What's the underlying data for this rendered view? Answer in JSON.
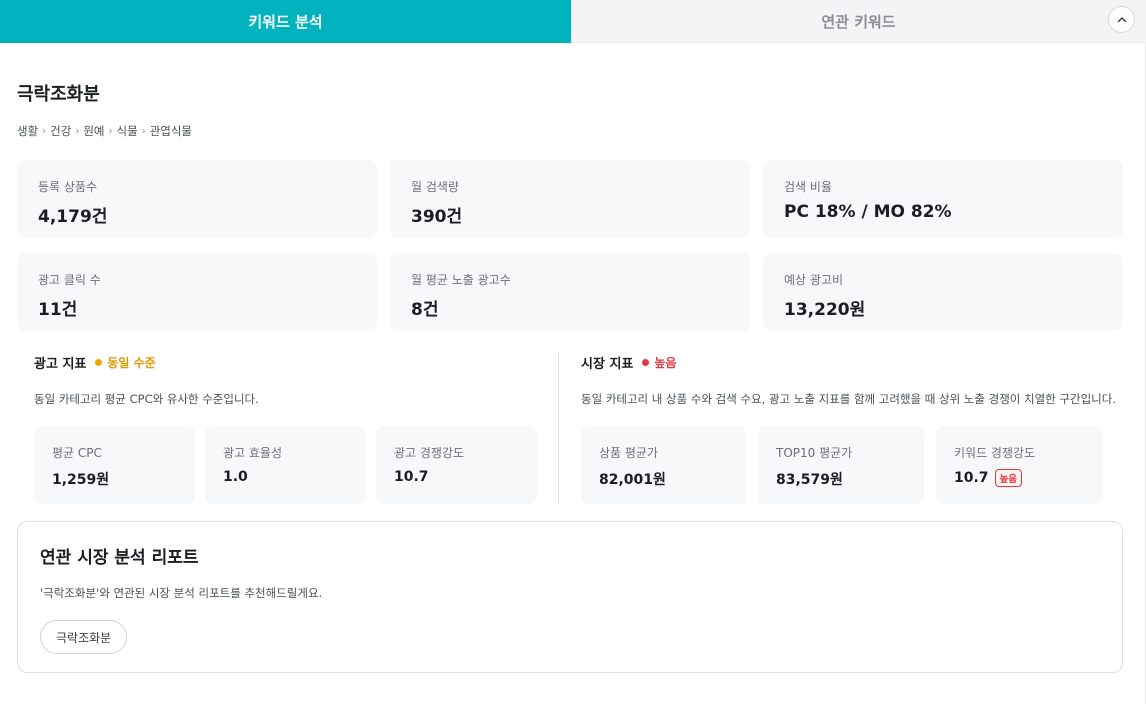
{
  "tabs": {
    "active": "키워드 분석",
    "inactive": "연관 키워드"
  },
  "colors": {
    "accent": "#00b3be",
    "warning": "#f0a500",
    "danger": "#e03a3e"
  },
  "keyword": {
    "title": "극락조화분",
    "breadcrumb": [
      "생활",
      "건강",
      "원예",
      "식물",
      "관엽식물"
    ]
  },
  "stats": [
    {
      "label": "등록 상품수",
      "value": "4,179건"
    },
    {
      "label": "월 검색량",
      "value": "390건"
    },
    {
      "label": "검색 비율",
      "value": "PC 18% / MO 82%"
    },
    {
      "label": "광고 클릭 수",
      "value": "11건"
    },
    {
      "label": "월 평균 노출 광고수",
      "value": "8건"
    },
    {
      "label": "예상 광고비",
      "value": "13,220원"
    }
  ],
  "ad_index": {
    "title": "광고 지표",
    "level": "동일 수준",
    "description": "동일 카테고리 평균 CPC와 유사한 수준입니다.",
    "cards": [
      {
        "label": "평균 CPC",
        "value": "1,259원"
      },
      {
        "label": "광고 효율성",
        "value": "1.0"
      },
      {
        "label": "광고 경쟁강도",
        "value": "10.7"
      }
    ]
  },
  "market_index": {
    "title": "시장 지표",
    "level": "높음",
    "description": "동일 카테고리 내 상품 수와 검색 수요, 광고 노출 지표를 함께 고려했을 때 상위 노출 경쟁이 치열한 구간입니다.",
    "cards": [
      {
        "label": "상품 평균가",
        "value": "82,001원"
      },
      {
        "label": "TOP10 평균가",
        "value": "83,579원"
      },
      {
        "label": "키워드 경쟁강도",
        "value": "10.7",
        "badge": "높음"
      }
    ]
  },
  "report": {
    "title": "연관 시장 분석 리포트",
    "description": "'극락조화분'와 연관된 시장 분석 리포트를 추천해드릴게요.",
    "chip": "극락조화분"
  }
}
